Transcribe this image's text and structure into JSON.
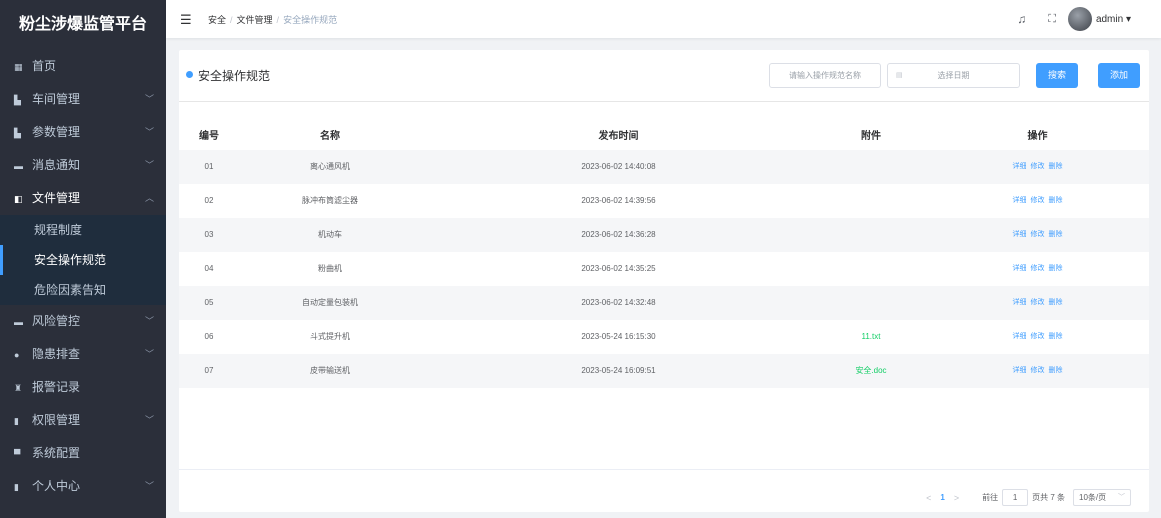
{
  "app": {
    "title": "粉尘涉爆监管平台"
  },
  "sidebar": {
    "items": [
      {
        "label": "首页",
        "icon": "home-icon",
        "glyph": "▦",
        "arrow": ""
      },
      {
        "label": "车间管理",
        "icon": "workshop-icon",
        "glyph": "▙",
        "arrow": "﹀"
      },
      {
        "label": "参数管理",
        "icon": "param-icon",
        "glyph": "▙",
        "arrow": "﹀"
      },
      {
        "label": "消息通知",
        "icon": "message-icon",
        "glyph": "▬",
        "arrow": "﹀"
      },
      {
        "label": "文件管理",
        "icon": "file-icon",
        "glyph": "◧",
        "arrow": "︿"
      },
      {
        "label": "风险管控",
        "icon": "risk-icon",
        "glyph": "▬",
        "arrow": "﹀"
      },
      {
        "label": "隐患排查",
        "icon": "hazard-icon",
        "glyph": "●",
        "arrow": "﹀"
      },
      {
        "label": "报警记录",
        "icon": "alarm-icon",
        "glyph": "♜",
        "arrow": ""
      },
      {
        "label": "权限管理",
        "icon": "permission-icon",
        "glyph": "▮",
        "arrow": "﹀"
      },
      {
        "label": "系统配置",
        "icon": "config-icon",
        "glyph": "▀",
        "arrow": ""
      },
      {
        "label": "个人中心",
        "icon": "user-center-icon",
        "glyph": "▮",
        "arrow": "﹀"
      }
    ],
    "file_submenu": [
      "规程制度",
      "安全操作规范",
      "危险因素告知"
    ]
  },
  "header": {
    "breadcrumb": [
      "安全",
      "文件管理",
      "安全操作规范"
    ],
    "username": "admin"
  },
  "main": {
    "title": "安全操作规范",
    "search": {
      "name_placeholder": "请输入操作规范名称",
      "date_placeholder": "选择日期"
    },
    "buttons": {
      "search": "搜索",
      "add": "添加"
    },
    "columns": [
      "编号",
      "名称",
      "发布时间",
      "附件",
      "操作"
    ],
    "actions": [
      "详细",
      "修改",
      "删除"
    ],
    "rows": [
      {
        "id": "01",
        "name": "离心通风机",
        "time": "2023-06-02 14:40:08",
        "attachment": ""
      },
      {
        "id": "02",
        "name": "脉冲布筒滤尘器",
        "time": "2023-06-02 14:39:56",
        "attachment": ""
      },
      {
        "id": "03",
        "name": "机动车",
        "time": "2023-06-02 14:36:28",
        "attachment": ""
      },
      {
        "id": "04",
        "name": "粉曲机",
        "time": "2023-06-02 14:35:25",
        "attachment": ""
      },
      {
        "id": "05",
        "name": "自动定量包装机",
        "time": "2023-06-02 14:32:48",
        "attachment": ""
      },
      {
        "id": "06",
        "name": "斗式提升机",
        "time": "2023-05-24 16:15:30",
        "attachment": "11.txt"
      },
      {
        "id": "07",
        "name": "皮带输送机",
        "time": "2023-05-24 16:09:51",
        "attachment": "安全.doc"
      }
    ]
  },
  "pagination": {
    "prev": "<",
    "next": ">",
    "current": "1",
    "goto_label": "前往",
    "goto_value": "1",
    "page_suffix": "页",
    "total": "共 7 条",
    "page_size": "10条/页"
  },
  "colors": {
    "sidebar_bg": "#2b2f3a",
    "accent": "#409eff",
    "attachment": "#13ce66"
  }
}
